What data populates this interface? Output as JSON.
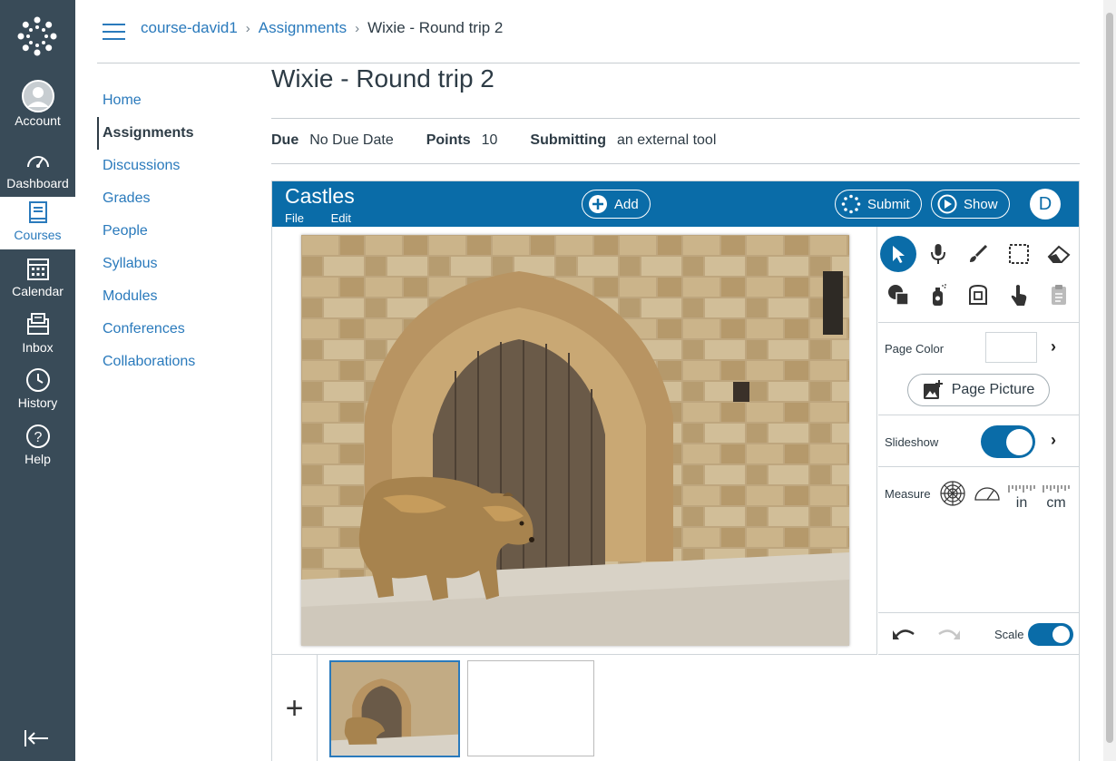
{
  "global_nav": {
    "items": [
      {
        "label": "Account",
        "icon": "avatar-icon"
      },
      {
        "label": "Dashboard",
        "icon": "dashboard-icon"
      },
      {
        "label": "Courses",
        "icon": "book-icon"
      },
      {
        "label": "Calendar",
        "icon": "calendar-icon"
      },
      {
        "label": "Inbox",
        "icon": "inbox-icon"
      },
      {
        "label": "History",
        "icon": "clock-icon"
      },
      {
        "label": "Help",
        "icon": "help-icon"
      }
    ]
  },
  "breadcrumb": {
    "course": "course-david1",
    "section": "Assignments",
    "current": "Wixie - Round trip 2"
  },
  "course_nav": {
    "items": [
      "Home",
      "Assignments",
      "Discussions",
      "Grades",
      "People",
      "Syllabus",
      "Modules",
      "Conferences",
      "Collaborations"
    ],
    "active": "Assignments"
  },
  "assignment": {
    "title": "Wixie - Round trip 2",
    "due_label": "Due",
    "due_value": "No Due Date",
    "points_label": "Points",
    "points_value": "10",
    "submitting_label": "Submitting",
    "submitting_value": "an external tool"
  },
  "wixie": {
    "project_title": "Castles",
    "menu": [
      "File",
      "Edit"
    ],
    "add_label": "Add",
    "submit_label": "Submit",
    "show_label": "Show",
    "user_initial": "D",
    "page_color_label": "Page Color",
    "page_picture_label": "Page Picture",
    "slideshow_label": "Slideshow",
    "slideshow_on": true,
    "measure_label": "Measure",
    "measure_in": "in",
    "measure_cm": "cm",
    "scale_label": "Scale",
    "scale_on": true,
    "add_page_symbol": "+",
    "brand_color": "#0a6ca8"
  }
}
